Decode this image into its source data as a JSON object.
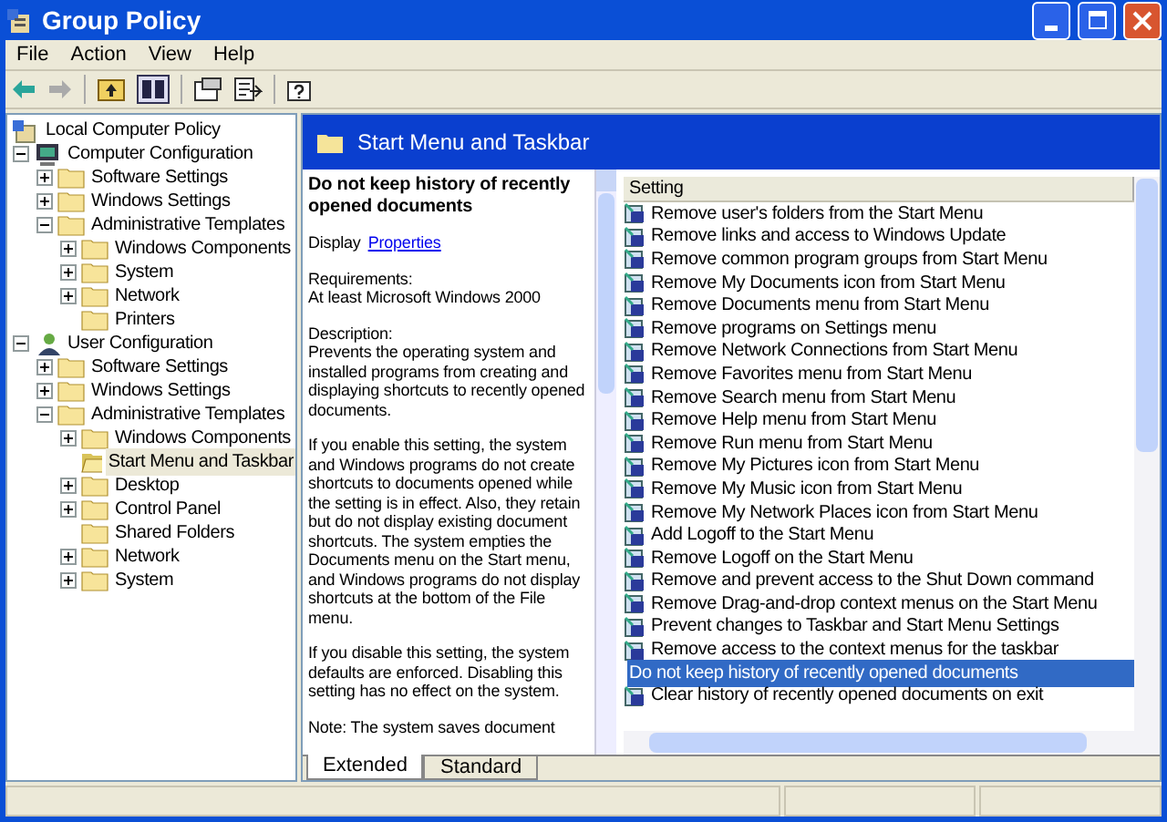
{
  "window": {
    "title": "Group Policy"
  },
  "menu": [
    "File",
    "Action",
    "View",
    "Help"
  ],
  "tree": [
    {
      "label": "Local Computer Policy",
      "kind": "leaf",
      "selected": false,
      "children": [
        {
          "label": "Computer Configuration",
          "kind": "expanded",
          "selected": false,
          "children": [
            {
              "label": "Software Settings",
              "kind": "collapsed",
              "selected": false
            },
            {
              "label": "Windows Settings",
              "kind": "collapsed",
              "selected": false
            },
            {
              "label": "Administrative Templates",
              "kind": "expanded",
              "selected": false,
              "children": [
                {
                  "label": "Windows Components",
                  "kind": "collapsed",
                  "selected": false
                },
                {
                  "label": "System",
                  "kind": "collapsed",
                  "selected": false
                },
                {
                  "label": "Network",
                  "kind": "collapsed",
                  "selected": false
                },
                {
                  "label": "Printers",
                  "kind": "leaf",
                  "selected": false
                }
              ]
            }
          ]
        },
        {
          "label": "User Configuration",
          "kind": "expanded",
          "selected": false,
          "children": [
            {
              "label": "Software Settings",
              "kind": "collapsed",
              "selected": false
            },
            {
              "label": "Windows Settings",
              "kind": "collapsed",
              "selected": false
            },
            {
              "label": "Administrative Templates",
              "kind": "expanded",
              "selected": false,
              "children": [
                {
                  "label": "Windows Components",
                  "kind": "collapsed",
                  "selected": false
                },
                {
                  "label": "Start Menu and Taskbar",
                  "kind": "leaf",
                  "selected": true
                },
                {
                  "label": "Desktop",
                  "kind": "collapsed",
                  "selected": false
                },
                {
                  "label": "Control Panel",
                  "kind": "collapsed",
                  "selected": false
                },
                {
                  "label": "Shared Folders",
                  "kind": "leaf",
                  "selected": false
                },
                {
                  "label": "Network",
                  "kind": "collapsed",
                  "selected": false
                },
                {
                  "label": "System",
                  "kind": "collapsed",
                  "selected": false
                }
              ]
            }
          ]
        }
      ]
    }
  ],
  "header": {
    "title": "Start Menu and Taskbar"
  },
  "description": {
    "title": "Do not keep history of recently opened documents",
    "display_label": "Display",
    "display_link": "Properties",
    "paragraphs": [
      "Requirements:\nAt least Microsoft Windows 2000",
      "Description:\nPrevents the operating system and installed programs from creating and displaying shortcuts to recently opened documents.",
      "If you enable this setting, the system and Windows programs do not create shortcuts to documents opened while the setting is in effect. Also, they retain but do not display existing document shortcuts. The system empties the Documents menu on the Start menu, and Windows programs do not display shortcuts at the bottom of the File menu.",
      "If you disable this setting, the system defaults are enforced. Disabling this setting has no effect on the system.",
      "Note: The system saves document"
    ]
  },
  "table": {
    "columns": [
      "Setting"
    ],
    "rows": [
      {
        "label": "Remove user's folders from the Start Menu",
        "selected": false
      },
      {
        "label": "Remove links and access to Windows Update",
        "selected": false
      },
      {
        "label": "Remove common program groups from Start Menu",
        "selected": false
      },
      {
        "label": "Remove My Documents icon from Start Menu",
        "selected": false
      },
      {
        "label": "Remove Documents menu from Start Menu",
        "selected": false
      },
      {
        "label": "Remove programs on Settings menu",
        "selected": false
      },
      {
        "label": "Remove Network Connections from Start Menu",
        "selected": false
      },
      {
        "label": "Remove Favorites menu from Start Menu",
        "selected": false
      },
      {
        "label": "Remove Search menu from Start Menu",
        "selected": false
      },
      {
        "label": "Remove Help menu from Start Menu",
        "selected": false
      },
      {
        "label": "Remove Run menu from Start Menu",
        "selected": false
      },
      {
        "label": "Remove My Pictures icon from Start Menu",
        "selected": false
      },
      {
        "label": "Remove My Music icon from Start Menu",
        "selected": false
      },
      {
        "label": "Remove My Network Places icon from Start Menu",
        "selected": false
      },
      {
        "label": "Add Logoff to the Start Menu",
        "selected": false
      },
      {
        "label": "Remove Logoff on the Start Menu",
        "selected": false
      },
      {
        "label": "Remove and prevent access to the Shut Down command",
        "selected": false
      },
      {
        "label": "Remove Drag-and-drop context menus on the Start Menu",
        "selected": false
      },
      {
        "label": "Prevent changes to Taskbar and Start Menu Settings",
        "selected": false
      },
      {
        "label": "Remove access to the context menus for the taskbar",
        "selected": false
      },
      {
        "label": "Do not keep history of recently opened documents",
        "selected": true
      },
      {
        "label": "Clear history of recently opened documents on exit",
        "selected": false
      }
    ]
  },
  "tabs": [
    {
      "label": "Extended",
      "selected": true
    },
    {
      "label": "Standard",
      "selected": false
    }
  ]
}
